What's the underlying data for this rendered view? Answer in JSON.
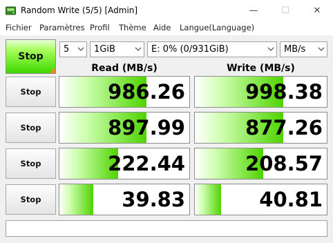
{
  "window": {
    "title": "Random Write (5/5) [Admin]",
    "minimize_glyph": "—",
    "maximize_glyph": "☐",
    "close_glyph": "✕"
  },
  "menu": [
    "Fichier",
    "Paramètres",
    "Profil",
    "Thème",
    "Aide",
    "Langue(Language)"
  ],
  "controls": {
    "main_button": "Stop",
    "count": "5",
    "size": "1GiB",
    "drive": "E: 0% (0/931GiB)",
    "unit": "MB/s"
  },
  "headers": {
    "read": "Read (MB/s)",
    "write": "Write (MB/s)"
  },
  "rows": [
    {
      "button": "Stop",
      "read": "986.26",
      "write": "998.38",
      "read_pct": 0.67,
      "write_pct": 0.67
    },
    {
      "button": "Stop",
      "read": "897.99",
      "write": "877.26",
      "read_pct": 0.67,
      "write_pct": 0.67
    },
    {
      "button": "Stop",
      "read": "222.44",
      "write": "208.57",
      "read_pct": 0.45,
      "write_pct": 0.52
    },
    {
      "button": "Stop",
      "read": "39.83",
      "write": "40.81",
      "read_pct": 0.26,
      "write_pct": 0.2
    }
  ],
  "colors": {
    "accent_green": "#4ed400",
    "corner_orange": "#ff7f27"
  },
  "icons": {
    "app": "disk-app-icon",
    "dropdown": "chevron-down-icon"
  },
  "comment": ""
}
